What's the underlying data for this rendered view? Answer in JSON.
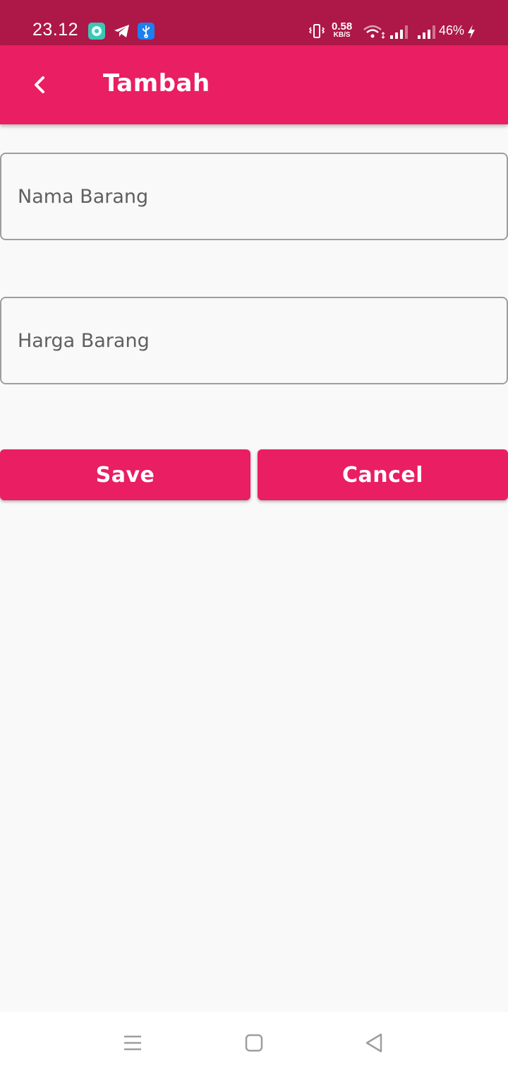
{
  "status_bar": {
    "time": "23.12",
    "net_speed_value": "0.58",
    "net_speed_unit": "KB/S",
    "battery": "46%",
    "icons": [
      "app-icon",
      "telegram-icon",
      "usb-icon",
      "vibrate-icon",
      "wifi-icon",
      "signal-icon",
      "signal-icon",
      "charging-icon"
    ],
    "bg_color": "#ad1848"
  },
  "app_bar": {
    "title": "Tambah",
    "back_icon": "chevron-left-icon",
    "bg_color": "#e91e63"
  },
  "form": {
    "nama_barang": {
      "placeholder": "Nama Barang",
      "value": ""
    },
    "harga_barang": {
      "placeholder": "Harga Barang",
      "value": ""
    }
  },
  "buttons": {
    "save_label": "Save",
    "cancel_label": "Cancel",
    "color": "#e91e63"
  },
  "nav_bar": {
    "icons": [
      "menu-icon",
      "home-icon",
      "back-icon"
    ]
  }
}
